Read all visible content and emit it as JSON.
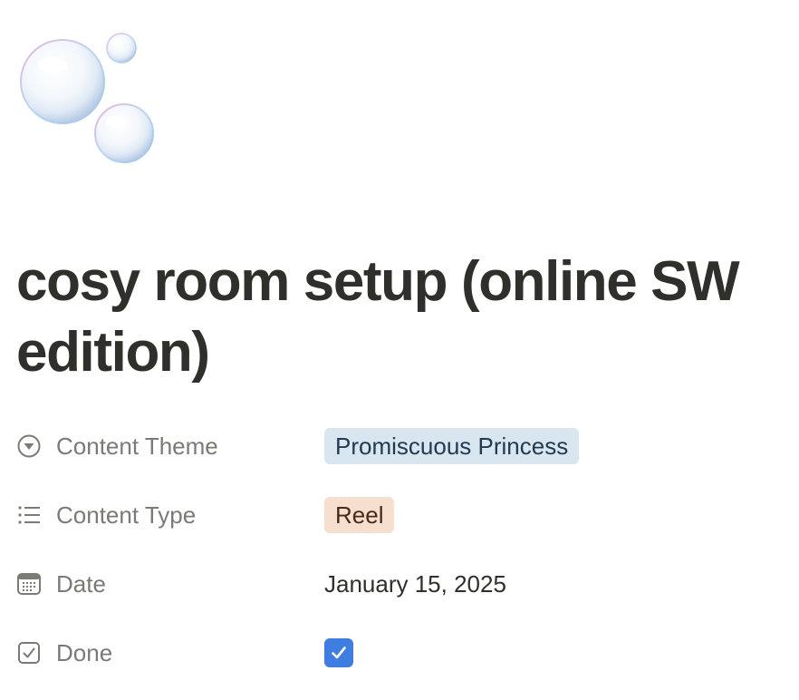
{
  "page": {
    "icon": "bubbles-emoji",
    "title": "cosy room setup (online SW edition)"
  },
  "properties": [
    {
      "name": "Content Theme",
      "icon": "select-icon",
      "value": "Promiscuous Princess",
      "value_type": "tag",
      "tag_color": "#d9e6f0"
    },
    {
      "name": "Content Type",
      "icon": "multi-select-icon",
      "value": "Reel",
      "value_type": "tag",
      "tag_color": "#f6dfcf"
    },
    {
      "name": "Date",
      "icon": "calendar-icon",
      "value": "January 15, 2025",
      "value_type": "date"
    },
    {
      "name": "Done",
      "icon": "checkbox-icon",
      "value": true,
      "value_type": "checkbox",
      "check_color": "#3f7ee0"
    }
  ]
}
